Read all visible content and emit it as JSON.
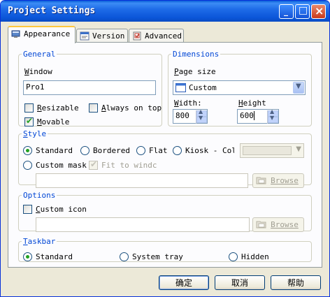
{
  "window": {
    "title": "Project Settings"
  },
  "title_buttons": {
    "minimize": "_",
    "maximize": "□",
    "close": "×"
  },
  "tabs": [
    {
      "label": "Appearance",
      "icon": "appearance-icon",
      "active": true
    },
    {
      "label": "Version",
      "icon": "version-icon",
      "active": false
    },
    {
      "label": "Advanced",
      "icon": "advanced-icon",
      "active": false
    }
  ],
  "general": {
    "legend": "General",
    "window_label_pre": "",
    "window_label_u": "W",
    "window_label_post": "indow",
    "window_value": "Pro1",
    "resizable_u": "R",
    "resizable_post": "esizable",
    "resizable_checked": false,
    "always_on_top_u": "A",
    "always_on_top_post": "lways on top",
    "always_on_top_checked": false,
    "movable_u": "M",
    "movable_post": "ovable",
    "movable_checked": true
  },
  "dimensions": {
    "legend": "Dimensions",
    "page_size_u": "P",
    "page_size_post": "age size",
    "page_size_value": "Custom",
    "width_u": "W",
    "width_post": "idth:",
    "width_value": "800",
    "height_u": "H",
    "height_post": "eight",
    "height_value": "600"
  },
  "style": {
    "legend_u": "S",
    "legend_post": "tyle",
    "standard": "Standard",
    "bordered": "Bordered",
    "flat": "Flat",
    "kiosk": "Kiosk - Colc",
    "custom_mask": "Custom mask",
    "fit_to_window": "Fit to windc",
    "browse": "Browse",
    "selected": "Standard"
  },
  "options": {
    "legend": "Options",
    "custom_icon_u": "C",
    "custom_icon_post": "ustom icon",
    "custom_icon_checked": false,
    "browse": "Browse"
  },
  "taskbar": {
    "legend_u": "T",
    "legend_post": "askbar",
    "standard": "Standard",
    "system_tray": "System tray",
    "hidden": "Hidden",
    "selected": "Standard"
  },
  "footer": {
    "ok": "确定",
    "cancel": "取消",
    "help": "帮助"
  },
  "colors": {
    "titlebar": "#0a5fd8",
    "legend": "#0046d5",
    "face": "#ece9d8",
    "check": "#21a121"
  }
}
